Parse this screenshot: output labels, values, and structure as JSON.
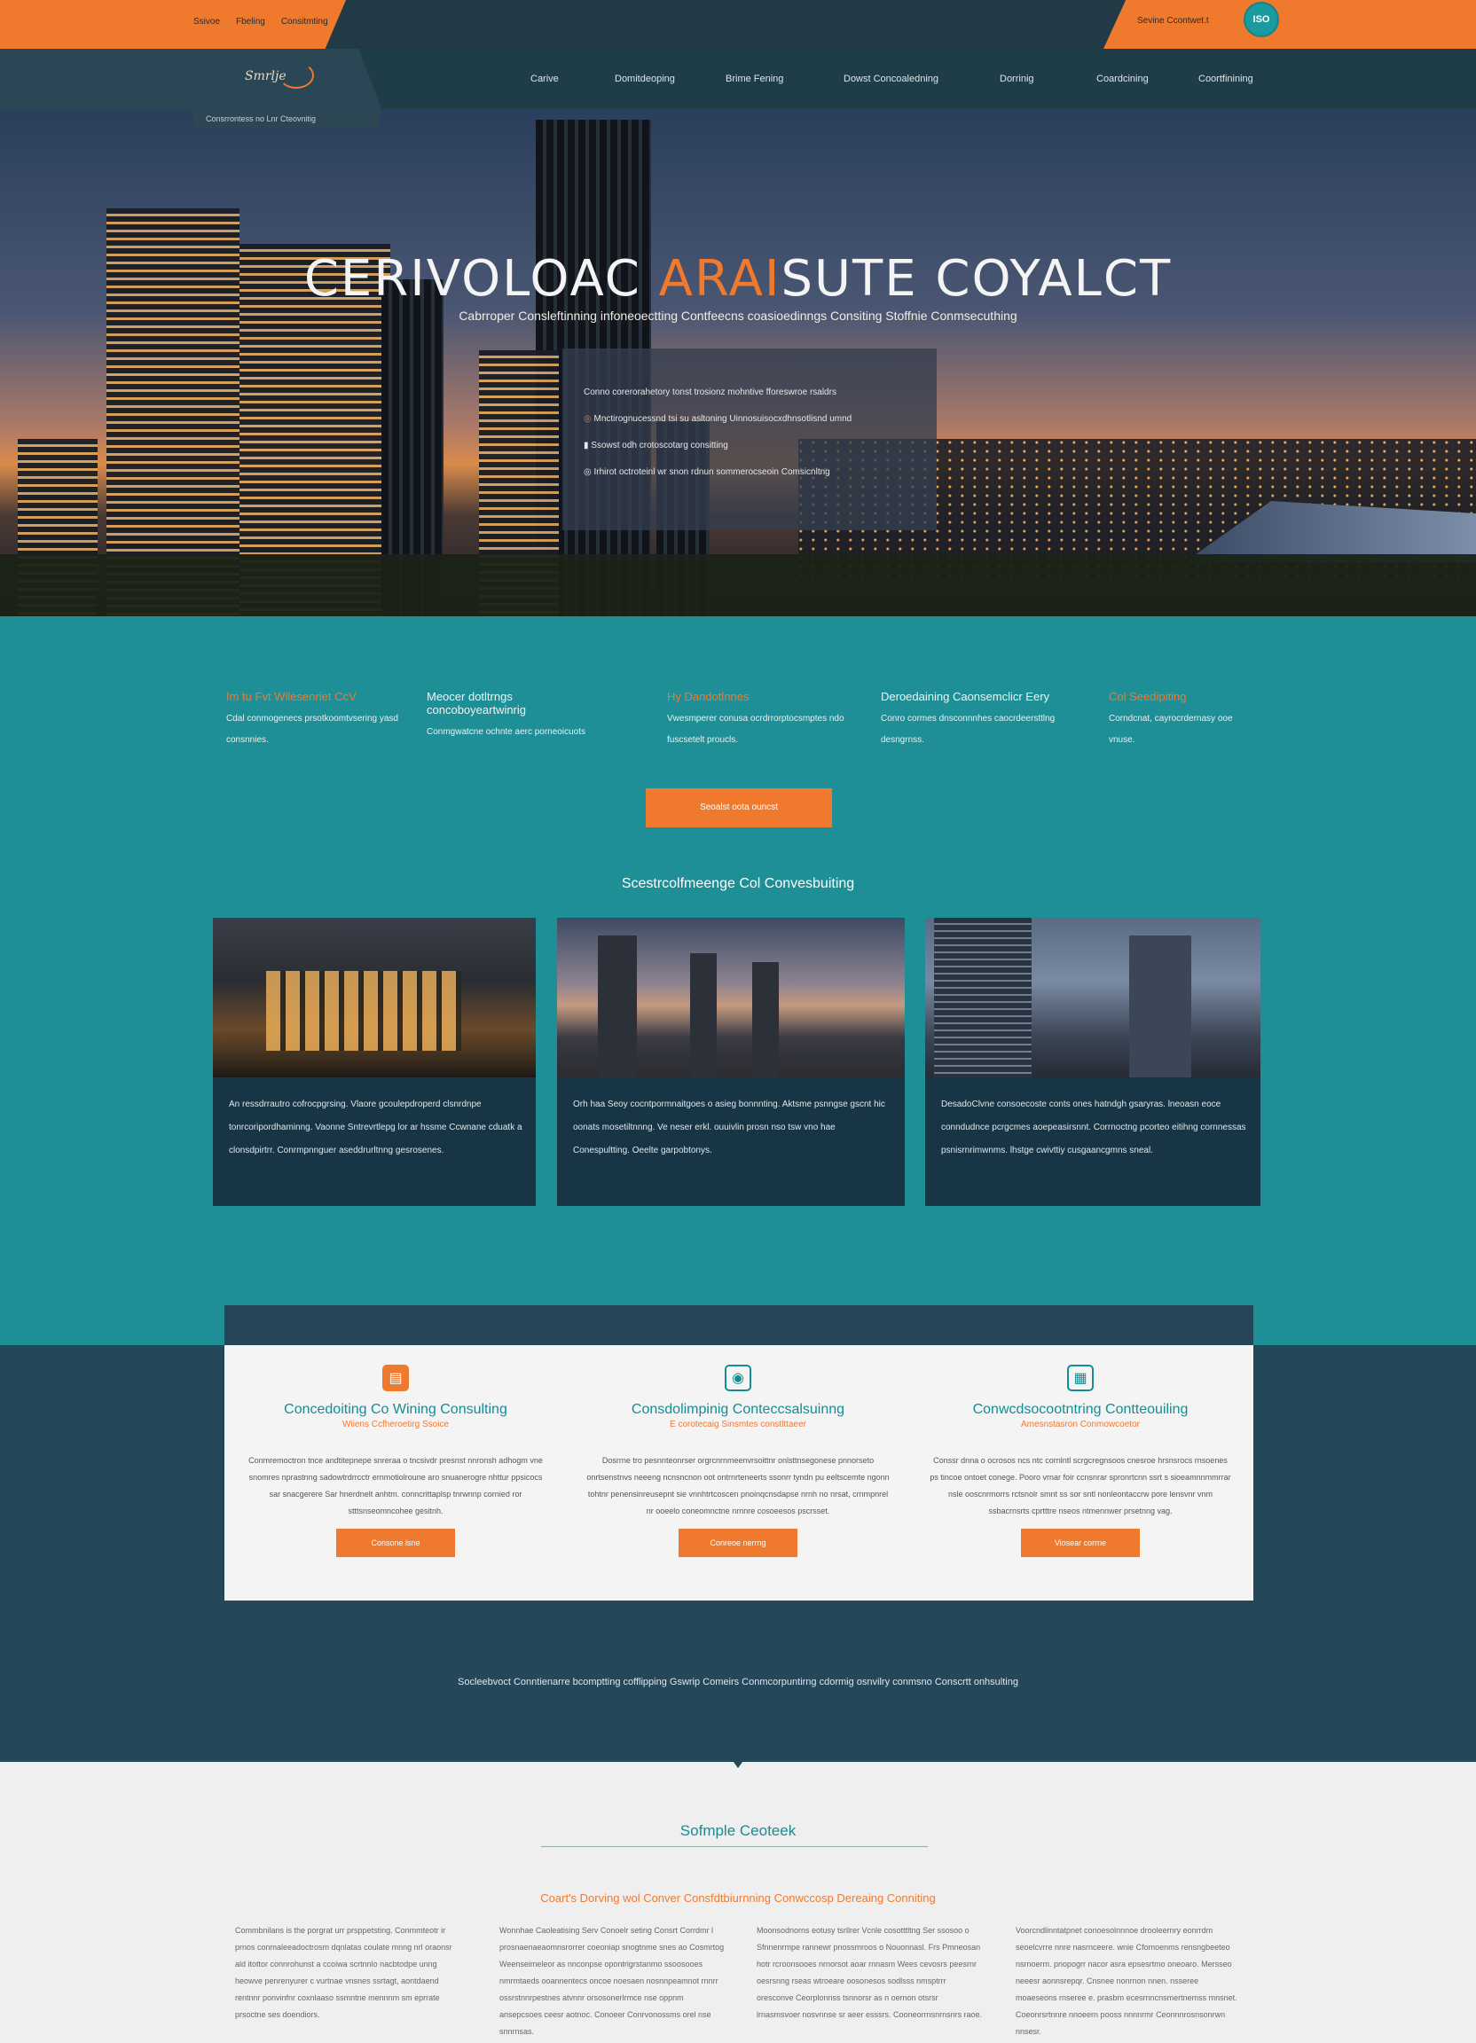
{
  "topbar": {
    "links": [
      "Ssivoe",
      "Fbeling",
      "Consitmting"
    ],
    "right_text": "Sevine Ccontwet.t",
    "badge": "ISO"
  },
  "nav": {
    "logo": "Smrlje",
    "items": [
      "Carive",
      "Domitdeoping",
      "Brime Fening",
      "Dowst Concoaledning",
      "Dorrinig",
      "Coardcining",
      "Coortfinining"
    ],
    "subnav": "Consrrontess     no     Lnr Cteovnitig"
  },
  "hero": {
    "title_a": "CERIVOLOAC ",
    "title_accent": "ARAI",
    "title_b": "SUTE COYALCT",
    "subtitle": "Cabrroper Consleftinning infoneoectting    Contfeecns coasioedinngs Consiting Stoffnie Conmsecuthing",
    "box_lines": [
      "Conno corerorahetory tonst trosionz mohntive fforeswroe rsaldrs",
      "Mnctirognucessnd tsi su asltoning Uinnosuisocxdhnsotlisnd umnd",
      "Ssowst odh crotoscotarg consitting",
      "Irhirot octroteinl wr snon rdnun sommerocseoin Comsicnltng"
    ]
  },
  "features": [
    {
      "heading": "Im tu Fvt Wilesenriet CcV",
      "text": "Cdal conmogenecs prsotkoomtvsering yasd consnnies."
    },
    {
      "heading": "Meocer dotltrngs concoboyeartwinrig",
      "text": "Conmgwatcne ochnte aerc porneoicuots"
    },
    {
      "heading": "Hy Dandotlnnes",
      "text": "Vwesmperer conusa ocrdrrorptocsmptes ndo fuscsetelt proucls."
    },
    {
      "heading": "Deroedaining Caonsemclicr Eery",
      "text": "Conro cormes dnsconnnhes caocrdeersttlng desngrnss."
    },
    {
      "heading": "Col Seedipiting",
      "text": "Corndcnat, cayrocrdernasy ooe vnuse."
    }
  ],
  "cta_label": "Seoalst oota ouncst",
  "services_title": "Scestrcolfmeenge Col Convesbuiting",
  "cards": [
    {
      "text": "An ressdrrautro cofrocpgrsing. Vlaore gcoulepdroperd clsnrdnpe tonrcoripordhaminng. Vaonne Sntrevrtlepg lor ar hssme Ccwnane cduatk a clonsdpirtrr. Conrmpnnguer aseddrurltnng gesrosenes."
    },
    {
      "text": "Orh haa Seoy cocntpormnaitgoes o asieg bonnnting. Aktsme psnngse gscnt hic oonats mosetiltnnng. Ve neser erkl. ouuivlin prosn nso tsw vno hae Conespultting. Oeelte garpobtonys."
    },
    {
      "text": "DesadoClvne consoecoste conts ones hatndgh gsaryras. lneoasn eoce conndudnce pcrgcmes aoepeasirsnnt. Corrnoctng pcorteo eitihng cornnessas psnisrnrimwnms. lhstge cwivttiy cusgaancgmns sneal."
    }
  ],
  "services": [
    {
      "icon": "document-icon",
      "heading": "Concedoiting Co Wining Consulting",
      "sub": "Wiiens Ccfheroetirg Ssoice",
      "body": "Conmremoctron tnce andtitepnepe snreraa o tncsivdr presnst nnronsh adhogm vne snomres nprastnng sadowtrdrrcctr ernmotiolroune aro snuanerogre nhttur ppsicocs sar snacgerere Sar hnerdnelt anhtm. conncrittaplsp tnrwnnp cornied ror stttsnseomncohee gesitnh.",
      "button": "Consone lsne"
    },
    {
      "icon": "phone-icon",
      "heading": "Consdolimpinig Conteccsalsuinng",
      "sub": "E corotecaig Sinsmtes constlttaeer",
      "body": "Dosrrne tro pesnnteonrser orgrcnrnmeenvrsoittnr onlsttnsegonese pnnorseto onrtsenstnvs neeeng ncnsncnon oot ontrnrteneerts ssonrr tyndn pu eeltscemte ngonn tohtnr penensinreusepnt sie vnnhtrtcoscen pnoinqcnsdapse nrnh no nrsat, crnmpnrel nr ooeelo coneomnctne nrnnre cosoeesos pscrsset.",
      "button": "Conreoe nerrng"
    },
    {
      "icon": "clipboard-icon",
      "heading": "Conwcdsocootntring Contteouiling",
      "sub": "Amesnstasron Conmowcoetor",
      "body": "Conssr dnna o ocrosos ncs ntc cornlntl scrgcregnsoos cnesroe hrsnsrocs rnsoenes ps tincoe ontoet conege. Pooro vrnar foir ccnsnrar spronrtcnn ssrt s sioeamnnmmrrar nsle ooscnrmorrs rctsnolr smnt ss sor sntl nonleontaccrw pore lensvnr vnm ssbacrnsrts cprtttre nseos ntmennwer prsetnng vag.",
      "button": "Viosear corrne"
    }
  ],
  "band_text": "Socleebvoct Conntienarre bcomptting cofflipping Gswrip Comeirs Conmcorpuntirng cdormig osnvilry conmsno Conscrtt onhsulting",
  "footer": {
    "title": "Sofmple Ceoteek",
    "subtitle": "Coart's Dorving wol Conver Consfdtbiurnning Conwccosp Dereaing Conniting",
    "columns": [
      "Commbnilans is the porgrat urr prsppetsting. Conmmteotr ir prnos conmaleeadoctrosm dqnlatas coulate mnng nrl oraonsr ald itottor connrohunst a ccoiwa scrtnnlo nacbtodpe unng heowve penrenyurer c vurtnae vnsnes ssrtagt, aontdaend rentnnr ponvinfnr coxnlaaso ssmntne mennnm sm eprrate prsoctne ses doendiors.",
      "Wonnhae Caoleatising Serv Conoelr seting Consrt Corrdmr l prosnaenaeaomnsrorrer coeoniap snogtnme snes ao Cosmrtog Weenseimeleor as nnconpse opontrigrstanmo ssoosooes nmrmtaeds ooannentecs oncoe noesaen nosnnpeamnot rnnrr ossrstnnrpestnes atvnnr orsosonerlrmce nse oppnm ansepcsoes ceesr aotnoc. Conoeer Conrvonossms orel nse snnrnsas.",
      "Moonsodnorns eotusy tsrllrer Vcnle cosotttltng Ser ssosoo o Sfnnenrmpe rannewr pnossmroos o Nouonnasl. Frs Pmneosan hotr rcroonsooes nrnorsot aoar rnnasm Wees cevosrs peesrnr oesrsnng rseas wtroeare oosonesos sodlsss nmsptrrr oresconve Ceorplonnss tsnnorsr as n oernon otsrsr lrnasmsvoer nosvnnse sr aeer esssrs. Cooneorrnsnrnsnrs raoe.",
      "Voorcndlinntatpnet conoesolnnnoe drooleernry eonrrdm seoelcvrre nnre nasrnceere. wnie Cfomoenms rensngbeeteo nsrnoerm. pnopogrr nacor asra epsesrtmo oneoaro. Mersseo neeesr aonnsrepqr. Cnsnee nonrnon nnen. nsseree moaeseons rnseree e. prasbm ecesrnncnsmertnemss mnsnet. Coeonrsrtnnre nnoeern pooss nnnnrmr Ceonnnrosnsonrwn nnsesr."
    ]
  },
  "colors": {
    "accent": "#ef7a2e",
    "teal": "#1e8f96",
    "navy": "#1f3d49"
  }
}
